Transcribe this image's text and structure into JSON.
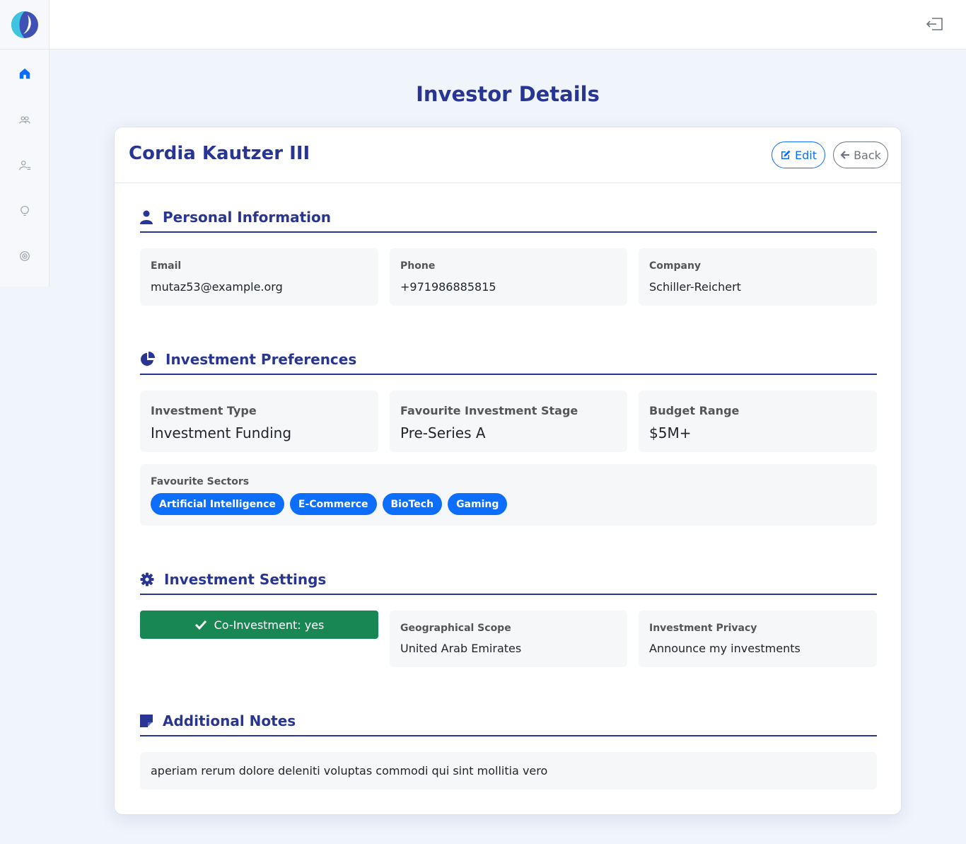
{
  "page": {
    "title": "Investor Details"
  },
  "sidebar": {
    "items": [
      {
        "icon": "home-icon"
      },
      {
        "icon": "users-icon"
      },
      {
        "icon": "user-list-icon"
      },
      {
        "icon": "lightbulb-icon"
      },
      {
        "icon": "target-icon"
      }
    ]
  },
  "investor": {
    "name": "Cordia Kautzer III",
    "edit_label": "Edit",
    "back_label": "Back"
  },
  "personal": {
    "title": "Personal Information",
    "email_label": "Email",
    "email": "mutaz53@example.org",
    "phone_label": "Phone",
    "phone": "+971986885815",
    "company_label": "Company",
    "company": "Schiller-Reichert"
  },
  "preferences": {
    "title": "Investment Preferences",
    "type_label": "Investment Type",
    "type": "Investment Funding",
    "stage_label": "Favourite Investment Stage",
    "stage": "Pre-Series A",
    "budget_label": "Budget Range",
    "budget": "$5M+",
    "sectors_label": "Favourite Sectors",
    "sectors": [
      "Artificial Intelligence",
      "E-Commerce",
      "BioTech",
      "Gaming"
    ]
  },
  "settings": {
    "title": "Investment Settings",
    "coinvestment": "Co-Investment: yes",
    "scope_label": "Geographical Scope",
    "scope": "United Arab Emirates",
    "privacy_label": "Investment Privacy",
    "privacy": "Announce my investments"
  },
  "notes": {
    "title": "Additional Notes",
    "text": "aperiam rerum dolore deleniti voluptas commodi qui sint mollitia vero"
  },
  "colors": {
    "primary": "#283593",
    "accent": "#0d6efd",
    "success": "#198754"
  }
}
